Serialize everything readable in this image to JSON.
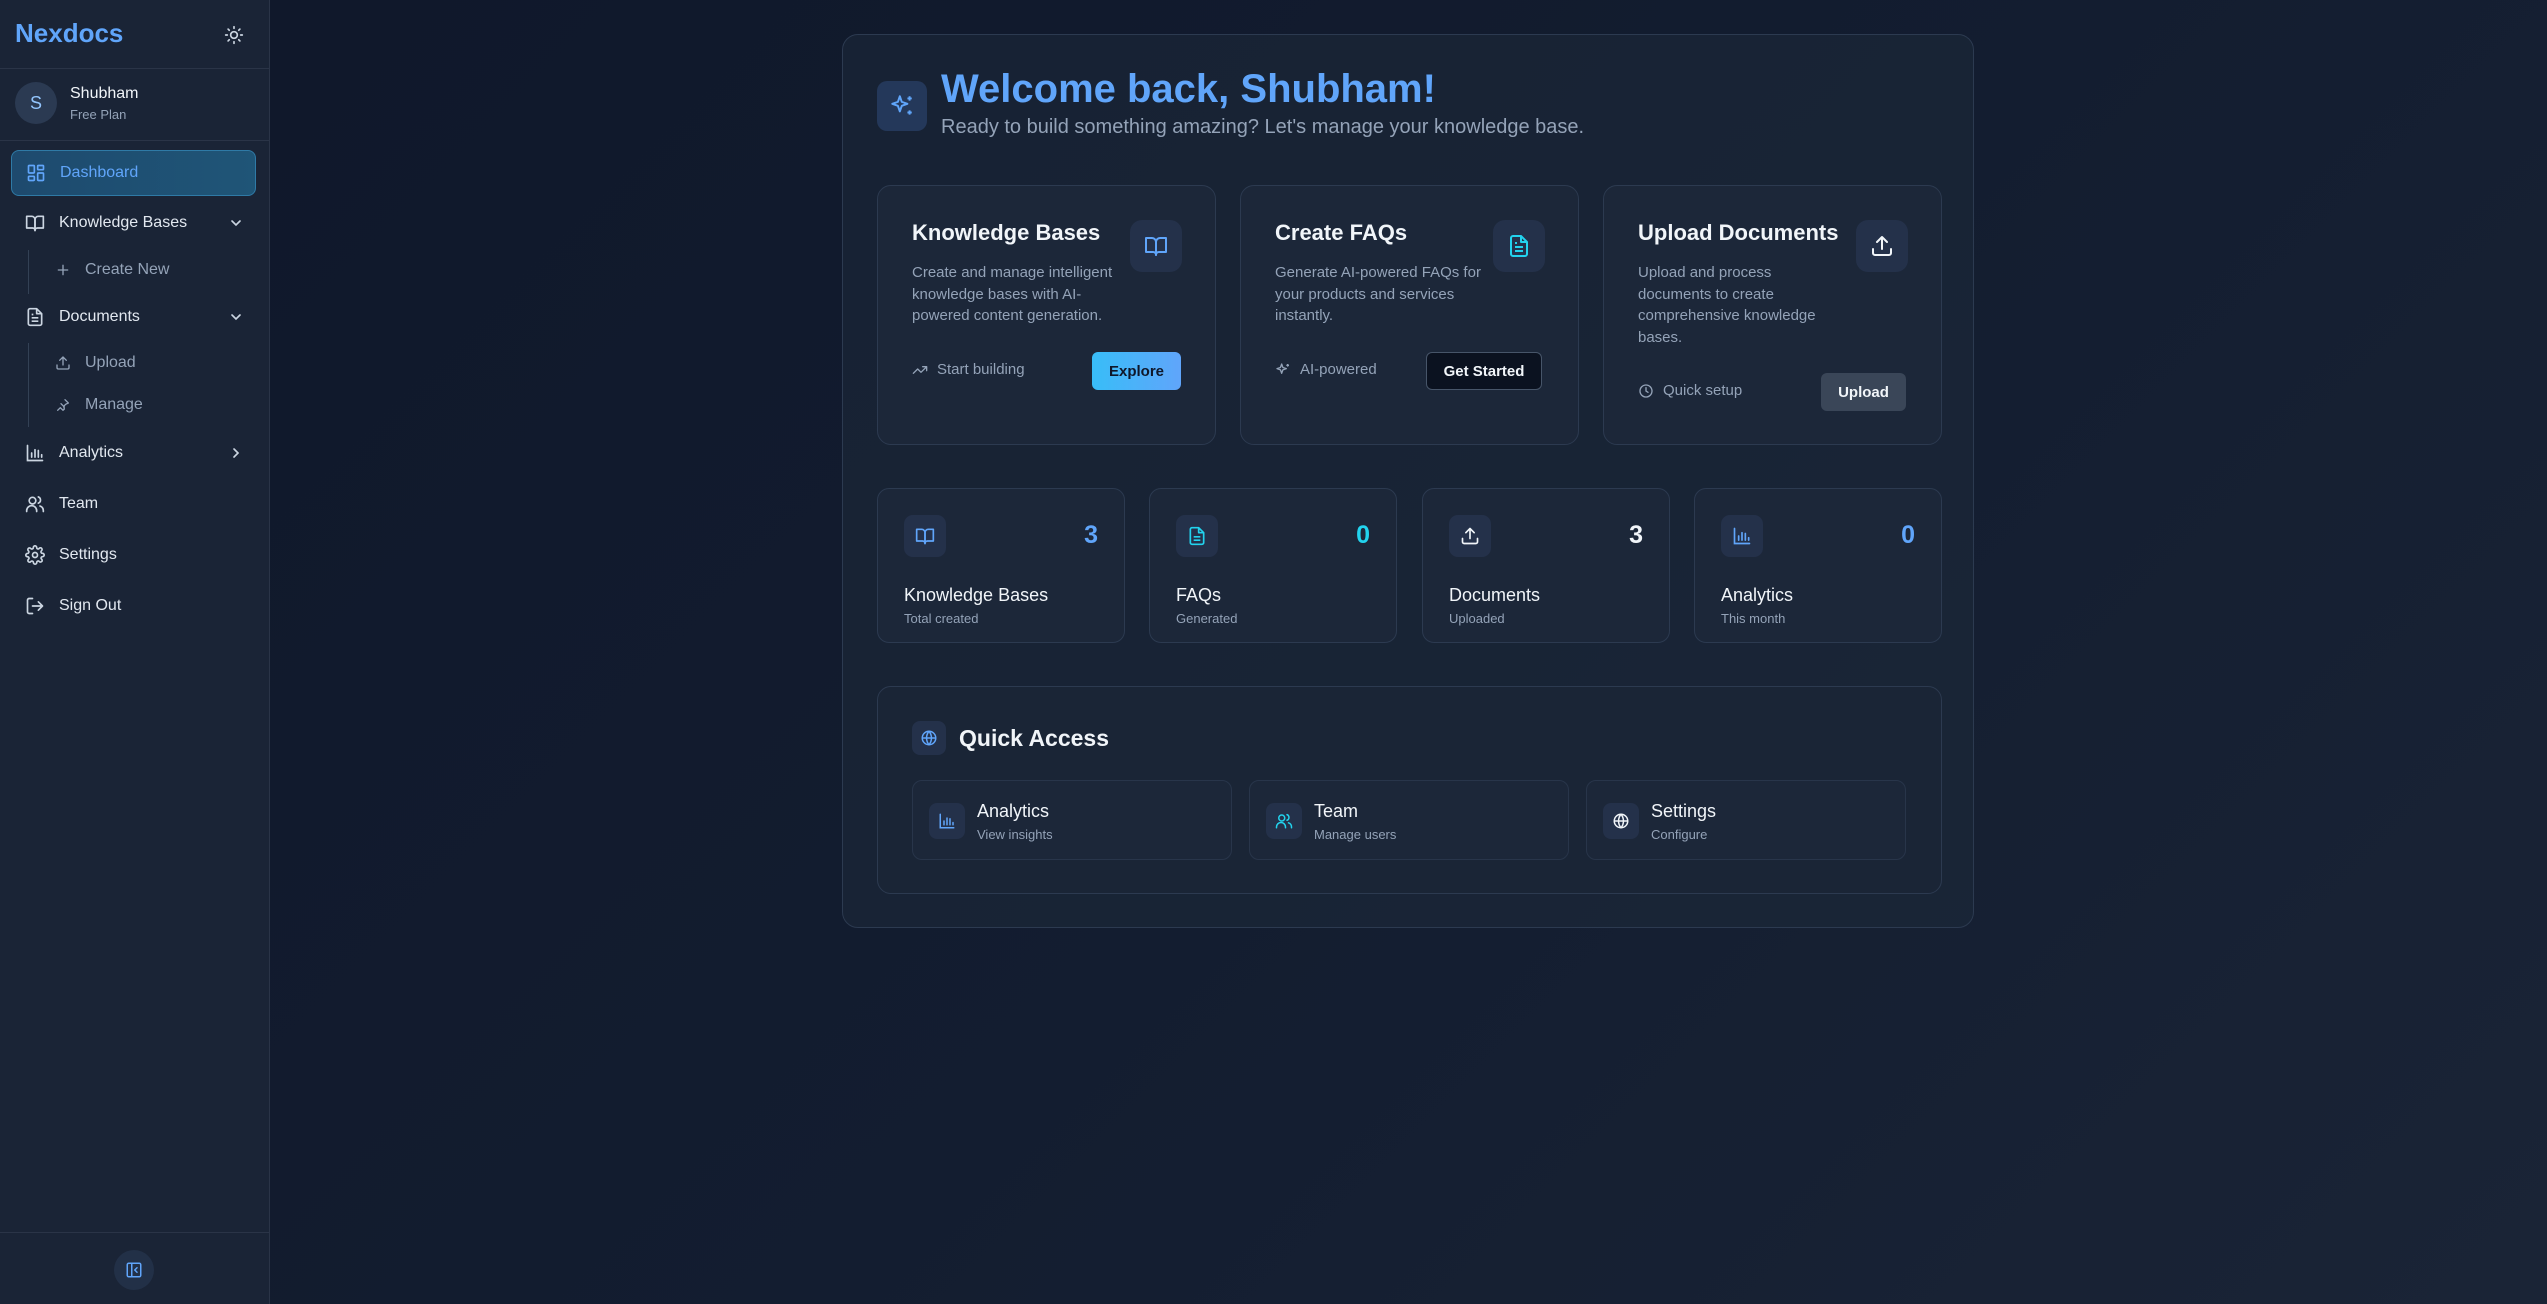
{
  "sidebar": {
    "brand": "Nexdocs",
    "user": {
      "initial": "S",
      "name": "Shubham",
      "plan": "Free Plan"
    },
    "items": [
      {
        "label": "Dashboard",
        "icon": "dashboard-icon",
        "active": true
      },
      {
        "label": "Knowledge Bases",
        "icon": "book-icon",
        "expanded": true,
        "children": [
          {
            "label": "Create New",
            "icon": "plus-icon"
          }
        ]
      },
      {
        "label": "Documents",
        "icon": "document-icon",
        "expanded": true,
        "children": [
          {
            "label": "Upload",
            "icon": "upload-icon"
          },
          {
            "label": "Manage",
            "icon": "pin-icon"
          }
        ]
      },
      {
        "label": "Analytics",
        "icon": "bar-chart-icon",
        "expanded": false
      },
      {
        "label": "Team",
        "icon": "users-icon"
      },
      {
        "label": "Settings",
        "icon": "gear-icon"
      },
      {
        "label": "Sign Out",
        "icon": "sign-out-icon"
      }
    ]
  },
  "welcome": {
    "title": "Welcome back, Shubham!",
    "subtitle": "Ready to build something amazing? Let's manage your knowledge base."
  },
  "feature_cards": [
    {
      "title": "Knowledge Bases",
      "description": "Create and manage intelligent knowledge bases with AI-powered content generation.",
      "meta": "Start building",
      "button": "Explore"
    },
    {
      "title": "Create FAQs",
      "description": "Generate AI-powered FAQs for your products and services instantly.",
      "meta": "AI-powered",
      "button": "Get Started"
    },
    {
      "title": "Upload Documents",
      "description": "Upload and process documents to create comprehensive knowledge bases.",
      "meta": "Quick setup",
      "button": "Upload"
    }
  ],
  "stats": [
    {
      "value": "3",
      "label": "Knowledge Bases",
      "sub": "Total created"
    },
    {
      "value": "0",
      "label": "FAQs",
      "sub": "Generated"
    },
    {
      "value": "3",
      "label": "Documents",
      "sub": "Uploaded"
    },
    {
      "value": "0",
      "label": "Analytics",
      "sub": "This month"
    }
  ],
  "quick_access": {
    "title": "Quick Access",
    "items": [
      {
        "title": "Analytics",
        "sub": "View insights"
      },
      {
        "title": "Team",
        "sub": "Manage users"
      },
      {
        "title": "Settings",
        "sub": "Configure"
      }
    ]
  },
  "colors": {
    "accent": "#60a5fa",
    "cyan": "#22d3ee",
    "background": "#0f172a",
    "sidebar": "#1a2436"
  }
}
